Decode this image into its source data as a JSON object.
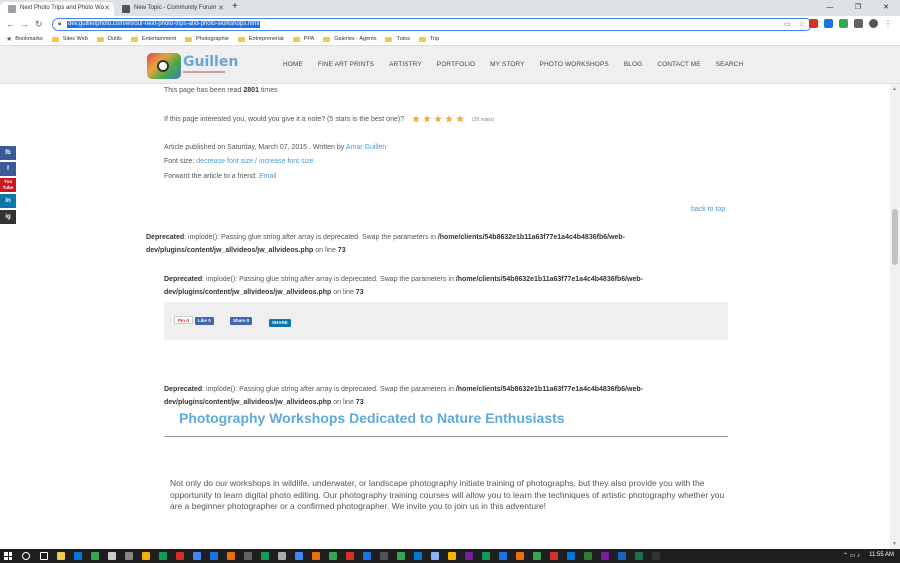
{
  "browser": {
    "tabs": [
      {
        "title": "Next Photo Trips and Photo Wo",
        "active": true
      },
      {
        "title": "New Topic - Community Forum",
        "active": false
      }
    ],
    "new_tab": "+",
    "window_controls": [
      "—",
      "❐",
      "✕"
    ],
    "url": "dev.guillenphoto.com/en/our-next-photo-trips-and-photo-workshops.html",
    "bookmarks": [
      "Bookmarks",
      "Sites Web",
      "Outils",
      "Entertainment",
      "Photographie",
      "Entrepreneriat",
      "PPA",
      "Galeries - Agents",
      "Tutos",
      "Trip"
    ]
  },
  "site": {
    "logo_text": "Guillen",
    "nav": [
      "HOME",
      "FINE ART PRINTS",
      "ARTISTRY",
      "PORTFOLIO",
      "MY STORY",
      "PHOTO WORKSHOPS",
      "BLOG",
      "CONTACT ME",
      "SEARCH"
    ],
    "social": [
      "fb",
      "f",
      "You Tube",
      "in",
      "ig"
    ]
  },
  "article": {
    "read_prefix": "This page has been read ",
    "read_count": "2801",
    "read_suffix": " times",
    "rating_question": "If this page interested you, would you give it a note? (5 stars is the best one)?",
    "stars": 5,
    "votes": "(39 votes)",
    "published_prefix": "Article published on Saturday, March 07, 2015 . Written by ",
    "author": "Amar Guillen",
    "font_size_prefix": "Font size: ",
    "font_decrease": "decrease font size",
    "font_separator": " / ",
    "font_increase": "increase font size",
    "forward_prefix": "Forward the article to a friend: ",
    "forward_link": "Email",
    "back_to_top": "back to top"
  },
  "notices": {
    "label": "Deprecated",
    "message": ": implode(): Passing glue string after array is deprecated. Swap the parameters in ",
    "path": "/home/clients/54b8632e1b11a63f77e1a4c4b4836fb6/web-dev/plugins/content/jw_allvideos/jw_allvideos.php",
    "path_part1": "/home/clients/54b8632e1b11a63f77e1a4c4b4836fb6/web-",
    "path_part2": "dev/plugins/content/jw_allvideos/jw_allvideos.php",
    "online": " on line ",
    "line": "73"
  },
  "share": {
    "pinit": "Pin it",
    "like": "Like 0",
    "share": "Share 0",
    "linkedin": "SHARE"
  },
  "section": {
    "title": "Photography Workshops Dedicated to Nature Enthusiasts",
    "intro": "Not only do our workshops in wildlife, underwater, or landscape photography initiate training of photographs, but they also provide you with the opportunity to learn digital photo editing. Our photography training courses will allow you to learn the techniques of artistic photography whether you are a beginner photographer or a confirmed photographer. We invite you to join us in this adventure!"
  },
  "taskbar": {
    "clock": "11:55 AM"
  },
  "colors": {
    "link": "#4a9cd6",
    "title": "#5fa9dd",
    "star": "#e58a1f",
    "facebook": "#3b5998",
    "youtube": "#cc181e",
    "linkedin": "#0e76a8"
  }
}
